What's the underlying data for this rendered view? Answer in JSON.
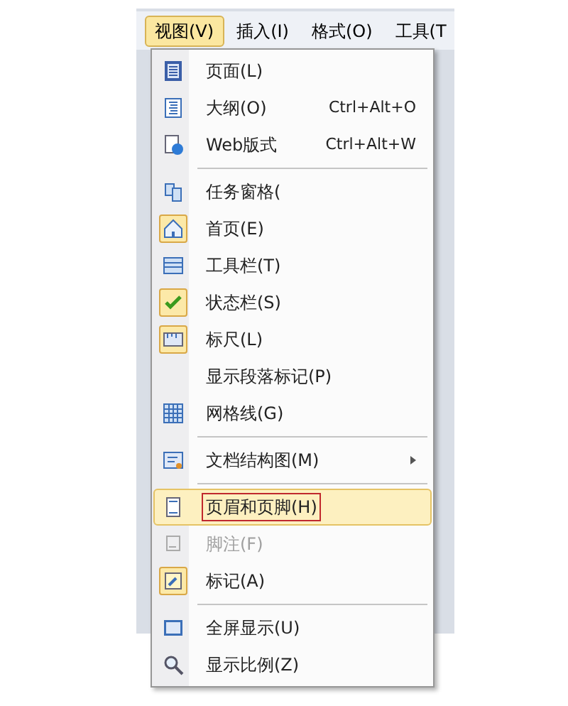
{
  "menu_bar": [
    {
      "label": "视图(V)",
      "selected": true
    },
    {
      "label": "插入(I)",
      "selected": false
    },
    {
      "label": "格式(O)",
      "selected": false
    },
    {
      "label": "工具(T",
      "selected": false
    }
  ],
  "menu": [
    {
      "kind": "item",
      "label": "页面(L)",
      "checked": false,
      "disabled": false,
      "selected": false
    },
    {
      "kind": "item",
      "label": "大纲(O)",
      "shortcut": "Ctrl+Alt+O",
      "checked": false,
      "disabled": false,
      "selected": false
    },
    {
      "kind": "item",
      "label": "Web版式",
      "shortcut": "Ctrl+Alt+W",
      "checked": false,
      "disabled": false,
      "selected": false
    },
    {
      "kind": "separator"
    },
    {
      "kind": "item",
      "label": "任务窗格(",
      "checked": false,
      "disabled": false,
      "selected": false
    },
    {
      "kind": "item",
      "label": "首页(E)",
      "checked": true,
      "disabled": false,
      "selected": false
    },
    {
      "kind": "item",
      "label": "工具栏(T)",
      "checked": false,
      "disabled": false,
      "selected": false
    },
    {
      "kind": "item",
      "label": "状态栏(S)",
      "checked": true,
      "disabled": false,
      "selected": false
    },
    {
      "kind": "item",
      "label": "标尺(L)",
      "checked": true,
      "disabled": false,
      "selected": false
    },
    {
      "kind": "item",
      "label": "显示段落标记(P)",
      "checked": false,
      "disabled": false,
      "selected": false
    },
    {
      "kind": "item",
      "label": "网格线(G)",
      "checked": false,
      "disabled": false,
      "selected": false
    },
    {
      "kind": "separator"
    },
    {
      "kind": "submenu",
      "label": "文档结构图(M)",
      "checked": false,
      "disabled": false,
      "selected": false
    },
    {
      "kind": "separator"
    },
    {
      "kind": "item",
      "label": "页眉和页脚(H)",
      "checked": false,
      "disabled": false,
      "selected": true
    },
    {
      "kind": "item",
      "label": "脚注(F)",
      "checked": false,
      "disabled": true,
      "selected": false
    },
    {
      "kind": "item",
      "label": "标记(A)",
      "checked": true,
      "disabled": false,
      "selected": false
    },
    {
      "kind": "separator"
    },
    {
      "kind": "item",
      "label": "全屏显示(U)",
      "checked": false,
      "disabled": false,
      "selected": false
    },
    {
      "kind": "item",
      "label": "显示比例(Z)",
      "checked": false,
      "disabled": false,
      "selected": false
    }
  ]
}
